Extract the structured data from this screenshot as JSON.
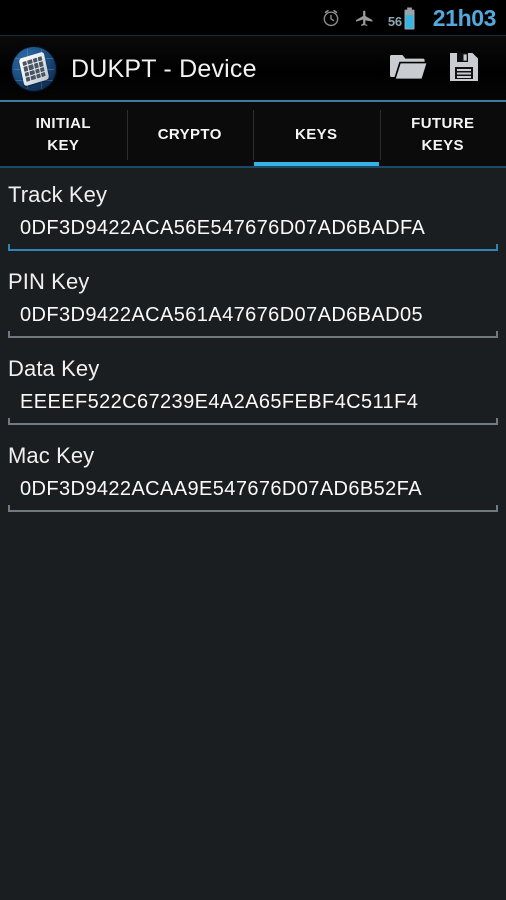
{
  "statusbar": {
    "icons": [
      "alarm-clock-icon",
      "airplane-mode-icon",
      "battery-icon"
    ],
    "battery_level": "56",
    "clock": "21h03",
    "clock_color": "#53a8dd",
    "battery_color": "#33b5e5"
  },
  "actionbar": {
    "app_icon": "dukpt-device-globe-icon",
    "title": "DUKPT - Device",
    "actions": [
      {
        "name": "open-folder-icon",
        "label": "Open"
      },
      {
        "name": "save-floppy-icon",
        "label": "Save"
      }
    ],
    "accent_color": "#3e7ba3"
  },
  "tabs": {
    "selected_index": 2,
    "indicator_color": "#3ab0e2",
    "items": [
      {
        "label": "INITIAL\nKEY",
        "line1": "INITIAL",
        "line2": "KEY"
      },
      {
        "label": "CRYPTO",
        "line1": "CRYPTO",
        "line2": ""
      },
      {
        "label": "KEYS",
        "line1": "KEYS",
        "line2": ""
      },
      {
        "label": "FUTURE\nKEYS",
        "line1": "FUTURE",
        "line2": "KEYS"
      }
    ]
  },
  "form": {
    "fields": [
      {
        "label": "Track Key",
        "value": "0DF3D9422ACA56E547676D07AD6BADFA",
        "placeholder": "Track Key",
        "focused": true
      },
      {
        "label": "PIN Key",
        "value": "0DF3D9422ACA561A47676D07AD6BAD05",
        "placeholder": "PIN Key",
        "focused": false
      },
      {
        "label": "Data Key",
        "value": "EEEEF522C67239E4A2A65FEBF4C511F4",
        "placeholder": "Data Key",
        "focused": false
      },
      {
        "label": "Mac Key",
        "value": "0DF3D9422ACAA9E547676D07AD6B52FA",
        "placeholder": "Mac Key",
        "focused": false
      }
    ]
  },
  "theme": {
    "background": "#1b1e21",
    "actionbar_background": "#000000",
    "accent": "#33b5e5",
    "text_primary": "#fafafa",
    "underline_idle": "#717a80",
    "underline_focused": "#2f84b5"
  }
}
